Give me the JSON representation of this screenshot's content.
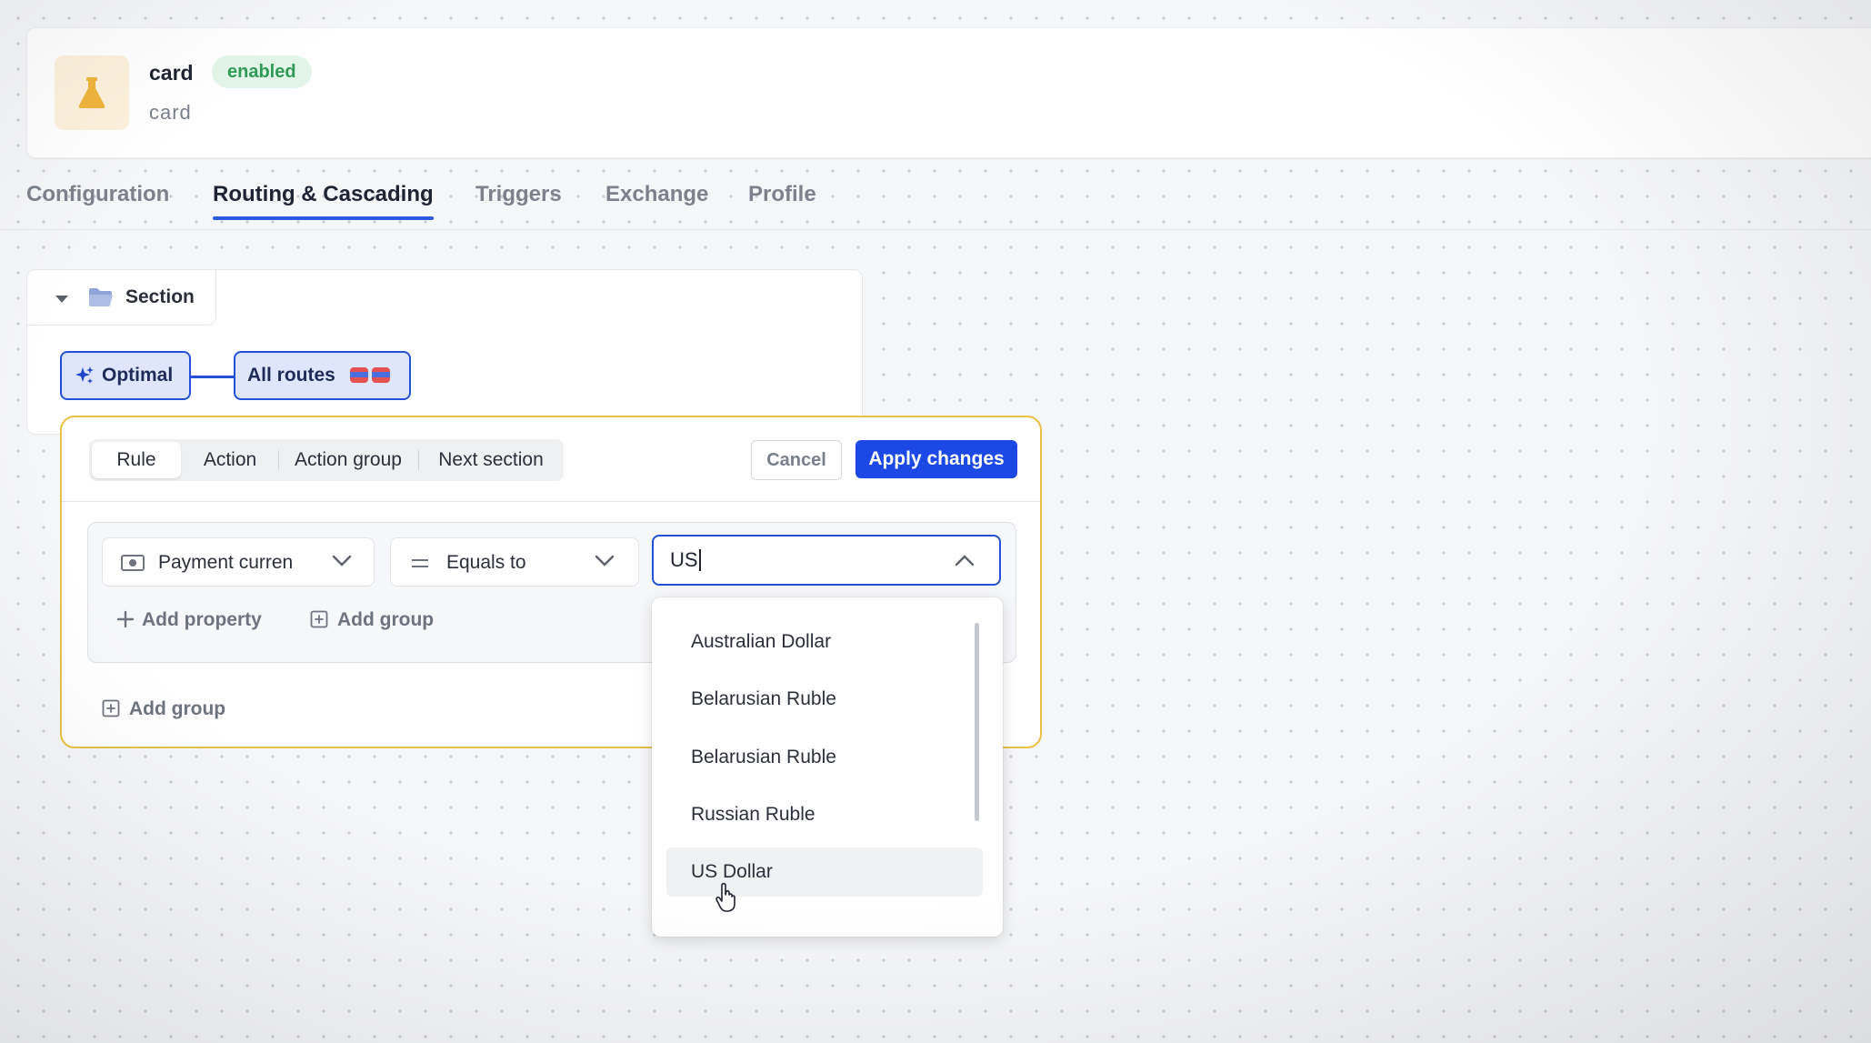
{
  "header": {
    "title": "card",
    "badge": "enabled",
    "subtitle": "card",
    "icon": "flask-icon",
    "accent": "#f0b43c"
  },
  "tabs": [
    {
      "label": "Configuration",
      "active": false
    },
    {
      "label": "Routing & Cascading",
      "active": true
    },
    {
      "label": "Triggers",
      "active": false
    },
    {
      "label": "Exchange",
      "active": false
    },
    {
      "label": "Profile",
      "active": false
    }
  ],
  "section": {
    "label": "Section",
    "nodes": {
      "optimal": "Optimal",
      "all_routes": "All routes"
    }
  },
  "editor": {
    "segments": [
      "Rule",
      "Action",
      "Action group",
      "Next section"
    ],
    "active_segment": "Rule",
    "cancel_label": "Cancel",
    "apply_label": "Apply changes",
    "condition": {
      "property": "Payment curren",
      "operator": "Equals to",
      "value": "US"
    },
    "add_property_label": "Add property",
    "add_group_inner_label": "Add group",
    "add_group_outer_label": "Add group"
  },
  "dropdown": {
    "options": [
      "Australian Dollar",
      "Belarusian Ruble",
      "Belarusian Ruble",
      "Russian Ruble",
      "US Dollar"
    ],
    "hovered": "US Dollar"
  },
  "colors": {
    "primary": "#1c48e6",
    "editor_border": "#e8c145",
    "badge_bg": "#e3f5e8",
    "badge_text": "#2f9a55"
  }
}
